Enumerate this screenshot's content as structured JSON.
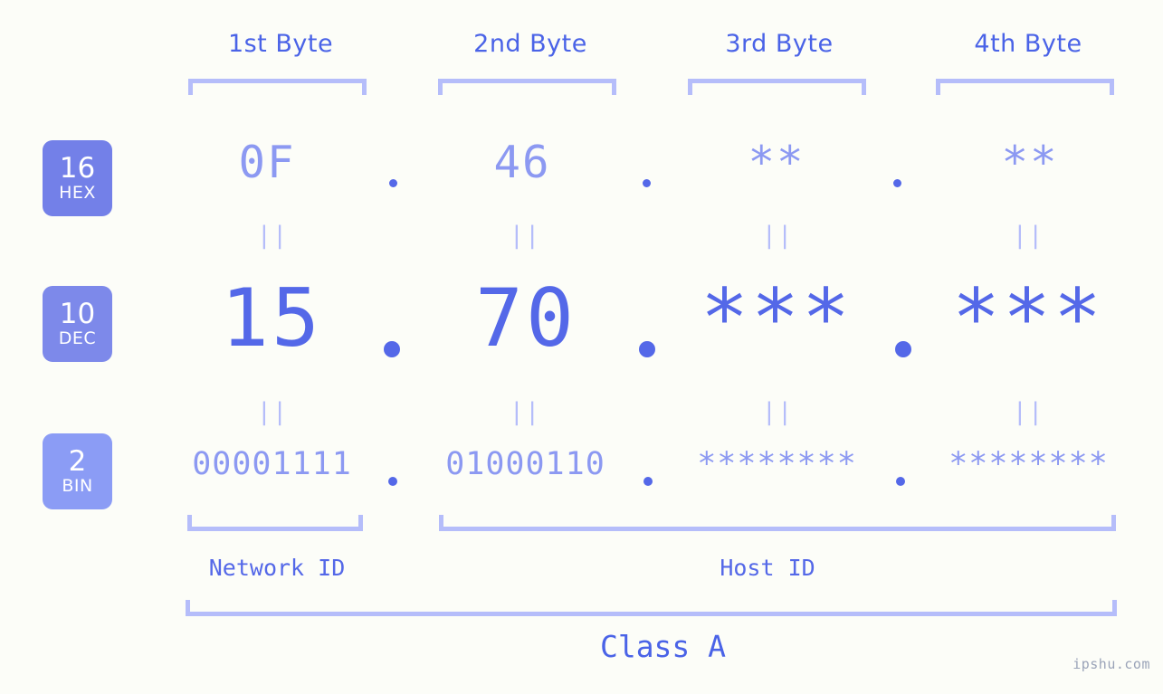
{
  "watermark": "ipshu.com",
  "colors": {
    "background": "#fcfdf8",
    "header_text": "#4a63e7",
    "bracket": "#b5bdfa",
    "badge_hex": "#7380e8",
    "badge_dec": "#7d89ea",
    "badge_bin": "#8b9cf5",
    "value_light": "#8c99f2",
    "value_strong": "#5468e8"
  },
  "headers": [
    {
      "label": "1st Byte"
    },
    {
      "label": "2nd Byte"
    },
    {
      "label": "3rd Byte"
    },
    {
      "label": "4th Byte"
    }
  ],
  "bases": [
    {
      "key": "hex",
      "number": "16",
      "name": "HEX"
    },
    {
      "key": "dec",
      "number": "10",
      "name": "DEC"
    },
    {
      "key": "bin",
      "number": "2",
      "name": "BIN"
    }
  ],
  "rows": {
    "hex": {
      "base_number": "16",
      "base_name": "HEX",
      "values": [
        "0F",
        "46",
        "**",
        "**"
      ],
      "separator": "."
    },
    "dec": {
      "base_number": "10",
      "base_name": "DEC",
      "values": [
        "15",
        "70",
        "***",
        "***"
      ],
      "separator": "."
    },
    "bin": {
      "base_number": "2",
      "base_name": "BIN",
      "values": [
        "00001111",
        "01000110",
        "********",
        "********"
      ],
      "separator": "."
    }
  },
  "equals_marker": "||",
  "segments": {
    "network_id": "Network ID",
    "host_id": "Host ID",
    "class": "Class A"
  }
}
